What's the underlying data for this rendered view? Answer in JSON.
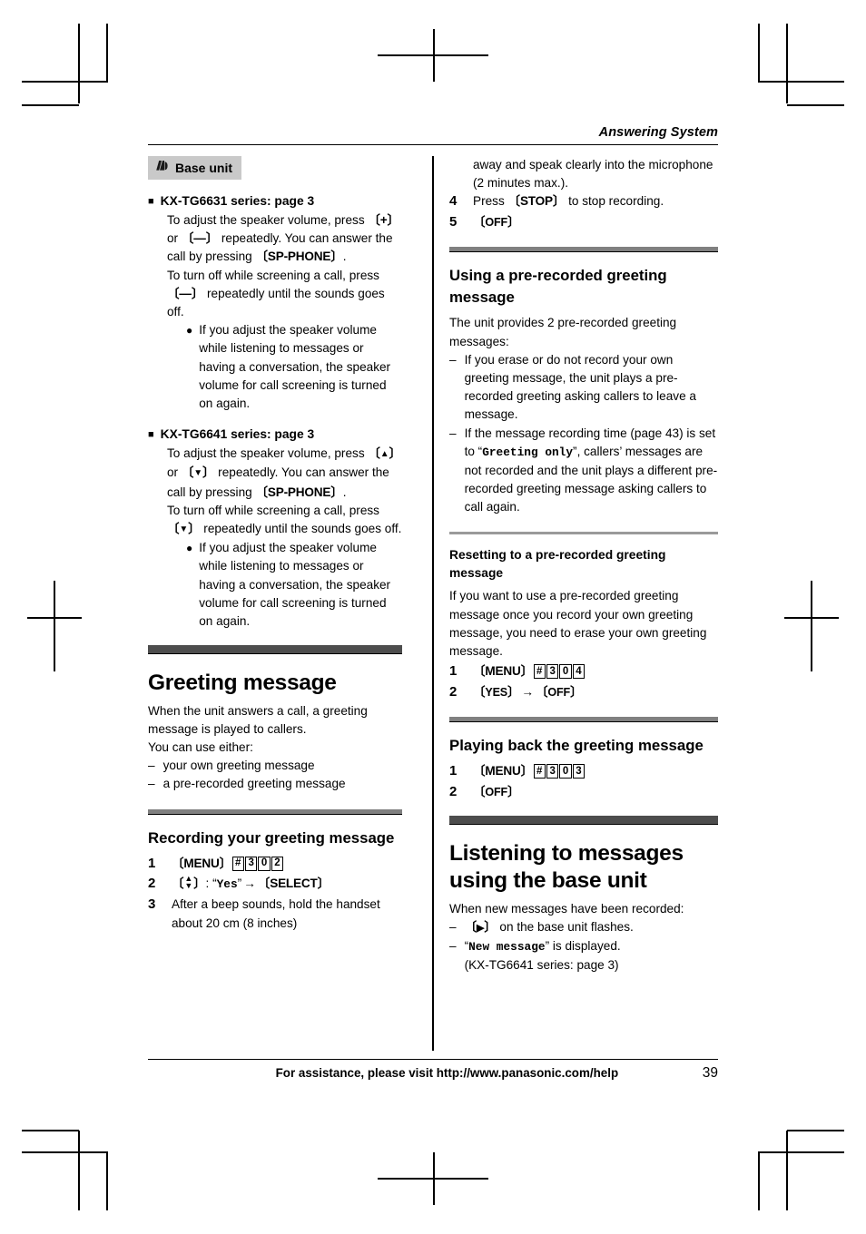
{
  "page": {
    "running_head": "Answering System",
    "page_number": "39",
    "footer_text": "For assistance, please visit http://www.panasonic.com/help"
  },
  "left_column": {
    "badge": {
      "label": "Base unit",
      "icon": "base-unit-icon"
    },
    "section_6631": {
      "heading": "KX-TG6631 series: page 3",
      "para1_a": "To adjust the speaker volume, press ",
      "key_plus": "+",
      "para1_b": " or ",
      "key_minus": "—",
      "para1_c": " repeatedly. You can answer the call by pressing ",
      "key_spphone": "SP-PHONE",
      "para1_d": ".",
      "para2_a": "To turn off while screening a call, press ",
      "para2_key": "—",
      "para2_b": " repeatedly until the sounds goes off.",
      "bullet": "If you adjust the speaker volume while listening to messages or having a conversation, the speaker volume for call screening is turned on again."
    },
    "section_6641": {
      "heading": "KX-TG6641 series: page 3",
      "para1_a": "To adjust the speaker volume, press ",
      "key_up": "▲",
      "para1_b": " or ",
      "key_down": "▼",
      "para1_c": " repeatedly. You can answer the call by pressing ",
      "key_spphone": "SP-PHONE",
      "para1_d": ".",
      "para2_a": "To turn off while screening a call, press ",
      "para2_key": "▼",
      "para2_b": " repeatedly until the sounds goes off.",
      "bullet": "If you adjust the speaker volume while listening to messages or having a conversation, the speaker volume for call screening is turned on again."
    },
    "greeting_message": {
      "title": "Greeting message",
      "intro": "When the unit answers a call, a greeting message is played to callers.",
      "intro2": "You can use either:",
      "options": [
        "your own greeting message",
        "a pre-recorded greeting message"
      ]
    },
    "recording": {
      "title": "Recording your greeting message",
      "step1": {
        "num": "1",
        "key_menu": "MENU",
        "boxes": [
          "#",
          "3",
          "0",
          "2"
        ]
      },
      "step2": {
        "num": "2",
        "nav_key": "▲▼",
        "colon": ": ",
        "display": "Yes",
        "arrow": "→",
        "key_select": "SELECT"
      },
      "step3": {
        "num": "3",
        "text": "After a beep sounds, hold the handset about 20 cm (8 inches)"
      }
    }
  },
  "right_column": {
    "continued_step3": "away and speak clearly into the microphone (2 minutes max.).",
    "step4": {
      "num": "4",
      "text_a": "Press ",
      "key_stop": "STOP",
      "text_b": " to stop recording."
    },
    "step5": {
      "num": "5",
      "key_off": "OFF"
    },
    "prerecorded": {
      "title": "Using a pre-recorded greeting message",
      "intro": "The unit provides 2 pre-recorded greeting messages:",
      "items": [
        {
          "text": "If you erase or do not record your own greeting message, the unit plays a pre-recorded greeting asking callers to leave a message."
        },
        {
          "text_a": "If the message recording time (page 43) is set to “",
          "display": "Greeting only",
          "text_b": "”, callers’ messages are not recorded and the unit plays a different pre-recorded greeting message asking callers to call again."
        }
      ]
    },
    "resetting": {
      "title": "Resetting to a pre-recorded greeting message",
      "para": "If you want to use a pre-recorded greeting message once you record your own greeting message, you need to erase your own greeting message.",
      "step1": {
        "num": "1",
        "key_menu": "MENU",
        "boxes": [
          "#",
          "3",
          "0",
          "4"
        ]
      },
      "step2": {
        "num": "2",
        "key_yes": "YES",
        "arrow": "→",
        "key_off": "OFF"
      }
    },
    "playing_back": {
      "title": "Playing back the greeting message",
      "step1": {
        "num": "1",
        "key_menu": "MENU",
        "boxes": [
          "#",
          "3",
          "0",
          "3"
        ]
      },
      "step2": {
        "num": "2",
        "key_off": "OFF"
      }
    },
    "listening": {
      "title": "Listening to messages using the base unit",
      "intro": "When new messages have been recorded:",
      "item1_key": "▶",
      "item1_text": " on the base unit flashes.",
      "item2_display": "New message",
      "item2_text": " is displayed.",
      "item2_note": "(KX-TG6641 series: page 3)"
    }
  }
}
